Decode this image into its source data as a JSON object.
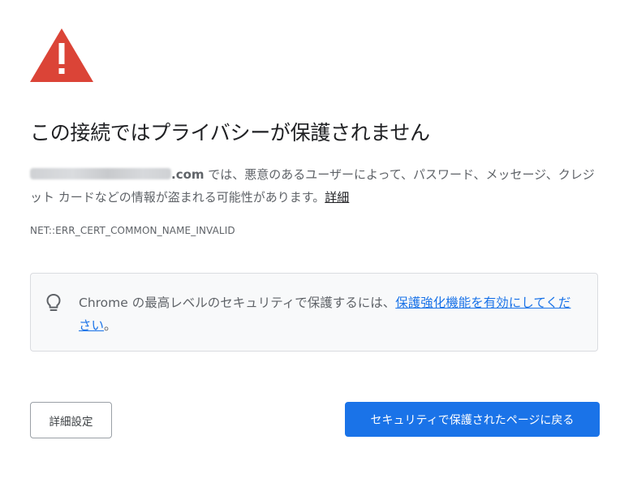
{
  "interstitial": {
    "icon": "warning-triangle-icon",
    "icon_color": "#db4437",
    "title": "この接続ではプライバシーが保護されません",
    "description": {
      "host_tld": ".com",
      "text": " では、悪意のあるユーザーによって、パスワード、メッセージ、クレジット カードなどの情報が盗まれる可能性があります。",
      "details_link": "詳細"
    },
    "error_code": "NET::ERR_CERT_COMMON_NAME_INVALID"
  },
  "tip": {
    "icon": "lightbulb-icon",
    "text_before": "Chrome の最高レベルのセキュリティで保護するには、",
    "link_text": "保護強化機能を有効にしてください",
    "text_after": "。",
    "link_color": "#1a73e8"
  },
  "buttons": {
    "advanced_label": "詳細設定",
    "back_label": "セキュリティで保護されたページに戻る",
    "primary_color": "#1a73e8"
  }
}
